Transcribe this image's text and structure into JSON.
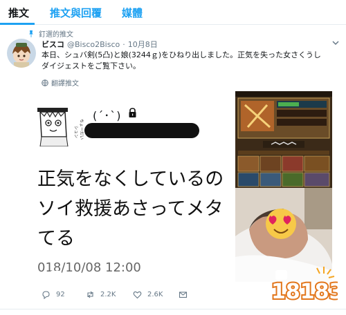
{
  "tabs": {
    "tweets": "推文",
    "tweets_replies": "推文與回覆",
    "media": "媒體"
  },
  "tweet": {
    "pinned": "釘選的推文",
    "name": "ビスコ",
    "handle": "@Bisco2Bisco",
    "sep": "·",
    "date": "10月8日",
    "text_line1": "本日、シュバ剣(5凸)と娘(3244ｇ)をひねり出しました。正気を失った女さくうし",
    "text_line2": "ダイジェストをご覧下さい。",
    "translate": "翻譯推文"
  },
  "media": {
    "kaomoji": "(ˊ･ˋ)",
    "line1": "正気をなくしているの",
    "line2": "ソイ救援あさってメタ",
    "line3": "てる",
    "timestamp": "018/10/08 12:00"
  },
  "actions": {
    "replies": "92",
    "retweets": "2.2K",
    "likes": "2.6K"
  },
  "watermark": {
    "text": "18183"
  },
  "colors": {
    "accent": "#1da1f2",
    "muted": "#657786"
  }
}
